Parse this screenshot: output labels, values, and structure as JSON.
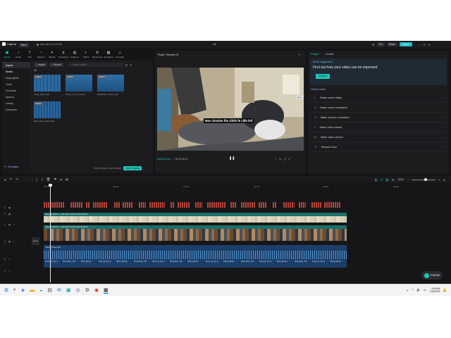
{
  "app": {
    "name": "CapCut",
    "menu_label": "Menu",
    "autosave": "Auto saved: 04:09:25",
    "project_title": "14",
    "pro_label": "Pro",
    "share_label": "Share",
    "export_label": "Export"
  },
  "toolbar": {
    "items": [
      {
        "label": "Media",
        "icon": "media-icon"
      },
      {
        "label": "Audio",
        "icon": "audio-icon"
      },
      {
        "label": "Text",
        "icon": "text-icon"
      },
      {
        "label": "Stickers",
        "icon": "sticker-icon"
      },
      {
        "label": "Effects",
        "icon": "effects-icon"
      },
      {
        "label": "Transitions",
        "icon": "transition-icon"
      },
      {
        "label": "Captions",
        "icon": "captions-icon"
      },
      {
        "label": "Filters",
        "icon": "filter-icon"
      },
      {
        "label": "Adjustment",
        "icon": "adjustment-icon"
      },
      {
        "label": "Templates",
        "icon": "template-icon"
      },
      {
        "label": "AI avatar",
        "icon": "ai-avatar-icon"
      }
    ]
  },
  "media_panel": {
    "sidebar": [
      "Import",
      "Media",
      "Subprojects",
      "Yours",
      "Generate",
      "Spaces",
      "Library",
      "Dreamina"
    ],
    "import_label": "Import",
    "record_label": "Record",
    "search_placeholder": "Search media",
    "filter_label": "All",
    "items": [
      {
        "tag": "Added",
        "name": "Vona_clarin.mp4"
      },
      {
        "tag": "Added",
        "name": "Food_on_the_ti.mp4"
      },
      {
        "tag": "Added",
        "name": "December_video.mp4"
      },
      {
        "tag": "Added",
        "name": "Wool_llama_clim.mp4"
      }
    ],
    "ai_shaper_label": "AI shaper",
    "hint_text": "Select media to get started",
    "start_label": "Start shaping"
  },
  "player": {
    "title": "Player Timeline 01",
    "subtitle": "Mas chrstins fits cllofn fe cilfe fell",
    "side_label": "Close",
    "current_time": "00:00:12:1a",
    "total_time": "00:00:38:27"
  },
  "right_panel": {
    "tab_project": "Project",
    "tab_details": "Details",
    "smart_heading": "Smart suggestions",
    "smart_text": "Find out how your video can be improved",
    "analyze_label": "Analyze",
    "global_heading": "Global edits",
    "edits": [
      "Make colors better",
      "Make colors consistent",
      "Make volume consistent",
      "Make voice clearer",
      "Make video clearer",
      "Retouch face"
    ]
  },
  "timeline": {
    "ruler": [
      "00:00",
      "|00:30",
      "|01:00",
      "|01:30",
      "|02:00",
      "|02:30",
      "|03:00"
    ],
    "zoom_label": "0:10",
    "track1_label": "Special effects - add  Filter sheets  00:00:38:27",
    "track2_label": "Special effects - add  Filter sheets  00:00:38:27",
    "cover_label": "Cover",
    "audio_label": "Voice_Over.mp3",
    "audio_clip_names": [
      "Food_on_the_ti",
      "December_Thir",
      "Wool_llamas",
      "Food_on_the_ti",
      "Wool_Dancer",
      "December_Thir",
      "Food_on_the_ti",
      "December_Thir",
      "Wool_llamas",
      "Food_on_the_ti",
      "Wool_Dancer",
      "December_Thir",
      "Food_on_the_ti",
      "Wool_llamas",
      "December_Thir",
      "Food_on_the_ti",
      "Wool_Dancer"
    ]
  },
  "editpilot": {
    "label": "EditPilot"
  },
  "taskbar": {
    "time": "4:59 AM",
    "date": "7/18/2025"
  }
}
